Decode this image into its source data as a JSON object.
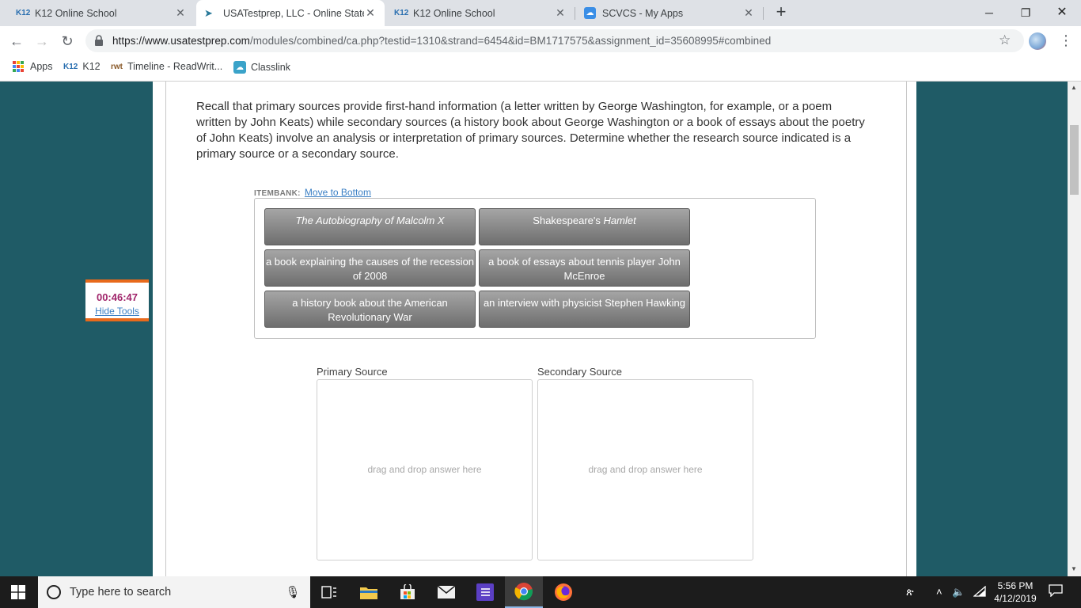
{
  "browser": {
    "tabs": [
      {
        "favicon": "K12",
        "title": "K12 Online School",
        "active": false
      },
      {
        "favicon": "cursor",
        "title": "USATestprep, LLC - Online State-",
        "active": true
      },
      {
        "favicon": "K12",
        "title": "K12 Online School",
        "active": false
      },
      {
        "favicon": "cloud",
        "title": "SCVCS - My Apps",
        "active": false
      }
    ],
    "url_host": "https://www.usatestprep.com",
    "url_path": "/modules/combined/ca.php?testid=1310&strand=6454&id=BM1717575&assignment_id=35608995#combined",
    "bookmarks": [
      {
        "icon": "apps-grid-icon",
        "label": "Apps"
      },
      {
        "icon": "K12",
        "label": "K12"
      },
      {
        "icon": "rwt",
        "label": "Timeline - ReadWrit..."
      },
      {
        "icon": "classlink-icon",
        "label": "Classlink"
      }
    ]
  },
  "question": {
    "prompt": "Recall that primary sources provide first-hand information (a letter written by George Washington, for example, or a poem written by John Keats) while secondary sources (a history book about George Washington or a book of essays about the poetry of John Keats) involve an analysis or interpretation of primary sources. Determine whether the research source indicated is a primary source or a secondary source.",
    "itembank_label": "ITEMBANK:",
    "move_link": "Move to Bottom",
    "items": {
      "autobiography": "The Autobiography of Malcolm X",
      "hamlet_pre": "Shakespeare's ",
      "hamlet_title": "Hamlet",
      "recession": "a book explaining the causes of the recession of 2008",
      "tennis": "a book of essays about tennis player John McEnroe",
      "history": "a history book about the American Revolutionary War",
      "interview": "an interview with physicist Stephen Hawking"
    },
    "zones": [
      {
        "label": "Primary Source",
        "hint": "drag and drop answer here"
      },
      {
        "label": "Secondary Source",
        "hint": "drag and drop answer here"
      }
    ]
  },
  "timer": {
    "time": "00:46:47",
    "hide_label": "Hide Tools"
  },
  "taskbar": {
    "search_placeholder": "Type here to search",
    "time": "5:56 PM",
    "date": "4/12/2019"
  },
  "colors": {
    "background": "#1f5b66",
    "timer_accent": "#e86a1c",
    "timer_text": "#a0246a",
    "link": "#3a7fc4"
  }
}
